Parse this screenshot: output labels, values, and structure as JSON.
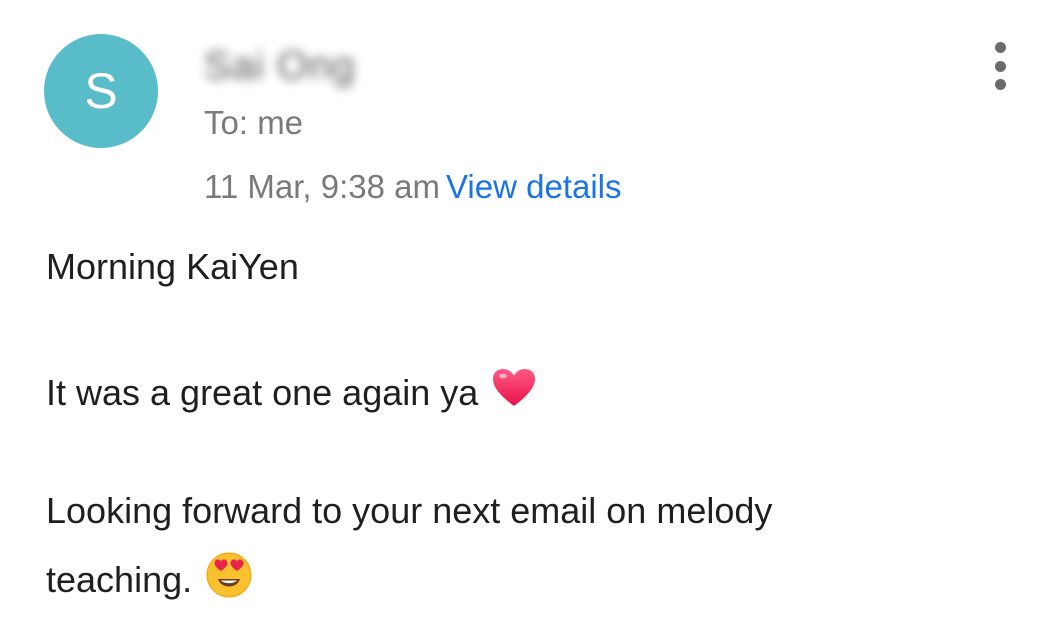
{
  "sender": {
    "avatar_letter": "S",
    "avatar_color": "#58bcc9",
    "name": "Sai Ong"
  },
  "recipient": {
    "label": "To: me"
  },
  "meta": {
    "date": "11 Mar, 9:38 am",
    "view_details": "View details"
  },
  "menu": {
    "icon": "more-vert-icon"
  },
  "body": {
    "greeting": "Morning KaiYen",
    "line2": "It was a great one again ya",
    "line2_emoji": "heart-icon",
    "line3": "Looking forward to your next email on melody",
    "line4": "teaching.",
    "line4_emoji": "heart-eyes-emoji"
  }
}
